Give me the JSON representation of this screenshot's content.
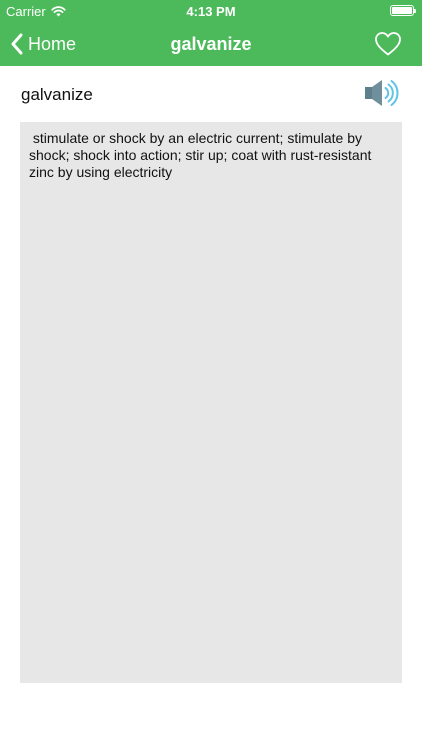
{
  "status_bar": {
    "carrier": "Carrier",
    "time": "4:13 PM",
    "battery_level": 1.0
  },
  "nav_bar": {
    "back_label": "Home",
    "title": "galvanize",
    "favorite_icon": "heart-outline-icon",
    "back_icon": "chevron-left-icon"
  },
  "word": {
    "term": "galvanize",
    "speaker_icon": "speaker-icon",
    "definition": " stimulate or shock by an electric current; stimulate by shock; shock into action; stir up; coat with rust-resistant zinc by using electricity"
  },
  "colors": {
    "nav_background": "#4cba5a",
    "definition_background": "#e7e7e7",
    "speaker_body": "#5e7f8c",
    "speaker_waves": "#5fc4e6"
  }
}
